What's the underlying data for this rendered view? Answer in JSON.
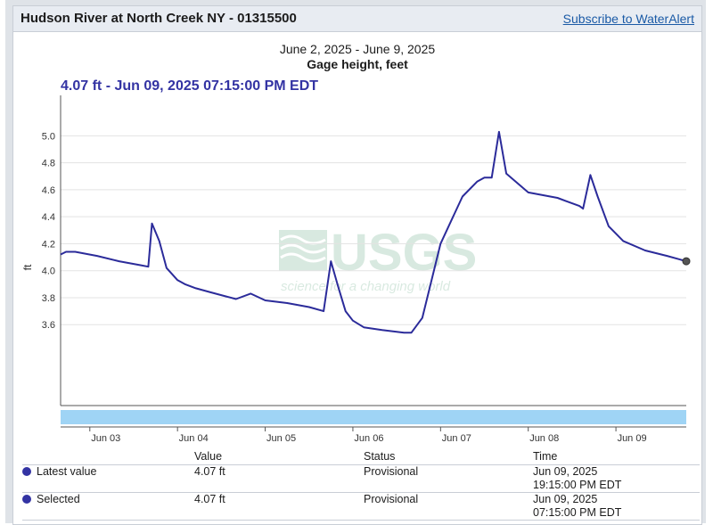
{
  "header": {
    "title": "Hudson River at North Creek NY - 01315500",
    "subscribe_label": "Subscribe to WaterAlert"
  },
  "chart_heading": {
    "date_range": "June 2, 2025 - June 9, 2025",
    "parameter": "Gage height, feet",
    "selected_readout": "4.07 ft - Jun 09, 2025 07:15:00 PM EDT"
  },
  "watermark": {
    "logo": "USGS",
    "tagline": "science for a changing world"
  },
  "colors": {
    "line": "#2b2b9a",
    "navigator": "#9fd4f5",
    "readout": "#3333a3"
  },
  "chart_data": {
    "type": "line",
    "title": "June 2, 2025 - June 9, 2025",
    "subtitle": "Gage height, feet",
    "ylabel": "ft",
    "xlabel": "",
    "ylim": [
      3.0,
      5.3
    ],
    "xlim": [
      "2025-06-02T16:00",
      "2025-06-09T19:15"
    ],
    "yticks": [
      3.6,
      3.8,
      4.0,
      4.2,
      4.4,
      4.6,
      4.8,
      5.0
    ],
    "ytick_labels": [
      "3.6",
      "3.8",
      "4.0",
      "4.2",
      "4.4",
      "4.6",
      "4.8",
      "5.0"
    ],
    "xticks": [
      "2025-06-03",
      "2025-06-04",
      "2025-06-05",
      "2025-06-06",
      "2025-06-07",
      "2025-06-08",
      "2025-06-09"
    ],
    "xtick_labels": [
      "Jun 03",
      "Jun 04",
      "Jun 05",
      "Jun 06",
      "Jun 07",
      "Jun 08",
      "Jun 09"
    ],
    "grid": true,
    "series": [
      {
        "name": "Gage height",
        "x": [
          "2025-06-02T16:00",
          "2025-06-02T17:30",
          "2025-06-02T20:00",
          "2025-06-03T02:00",
          "2025-06-03T08:00",
          "2025-06-03T14:00",
          "2025-06-03T16:00",
          "2025-06-03T17:00",
          "2025-06-03T19:00",
          "2025-06-03T21:00",
          "2025-06-04T00:00",
          "2025-06-04T02:00",
          "2025-06-04T05:00",
          "2025-06-04T09:00",
          "2025-06-04T16:00",
          "2025-06-04T20:00",
          "2025-06-05T00:00",
          "2025-06-05T06:00",
          "2025-06-05T12:00",
          "2025-06-05T16:00",
          "2025-06-05T18:00",
          "2025-06-05T20:00",
          "2025-06-05T22:00",
          "2025-06-06T00:00",
          "2025-06-06T03:00",
          "2025-06-06T08:00",
          "2025-06-06T14:00",
          "2025-06-06T16:00",
          "2025-06-06T19:00",
          "2025-06-07T00:00",
          "2025-06-07T06:00",
          "2025-06-07T10:00",
          "2025-06-07T12:00",
          "2025-06-07T14:00",
          "2025-06-07T16:00",
          "2025-06-07T18:00",
          "2025-06-08T00:00",
          "2025-06-08T08:00",
          "2025-06-08T14:00",
          "2025-06-08T15:00",
          "2025-06-08T17:00",
          "2025-06-08T19:00",
          "2025-06-08T22:00",
          "2025-06-09T02:00",
          "2025-06-09T08:00",
          "2025-06-09T14:00",
          "2025-06-09T19:15"
        ],
        "y": [
          4.12,
          4.14,
          4.14,
          4.11,
          4.07,
          4.04,
          4.03,
          4.35,
          4.22,
          4.02,
          3.93,
          3.9,
          3.87,
          3.84,
          3.79,
          3.83,
          3.78,
          3.76,
          3.73,
          3.7,
          4.07,
          3.88,
          3.7,
          3.63,
          3.58,
          3.56,
          3.54,
          3.54,
          3.65,
          4.2,
          4.55,
          4.66,
          4.69,
          4.69,
          5.03,
          4.72,
          4.58,
          4.54,
          4.48,
          4.46,
          4.71,
          4.55,
          4.33,
          4.22,
          4.15,
          4.11,
          4.07
        ]
      }
    ],
    "selected_point": {
      "x": "2025-06-09T19:15",
      "y": 4.07
    }
  },
  "table": {
    "headers": {
      "label": "",
      "value": "Value",
      "status": "Status",
      "time": "Time"
    },
    "rows": [
      {
        "label": "Latest value",
        "value": "4.07 ft",
        "status": "Provisional",
        "date": "Jun 09, 2025",
        "clock": "19:15:00 PM EDT"
      },
      {
        "label": "Selected",
        "value": "4.07 ft",
        "status": "Provisional",
        "date": "Jun 09, 2025",
        "clock": "07:15:00 PM EDT"
      }
    ]
  }
}
